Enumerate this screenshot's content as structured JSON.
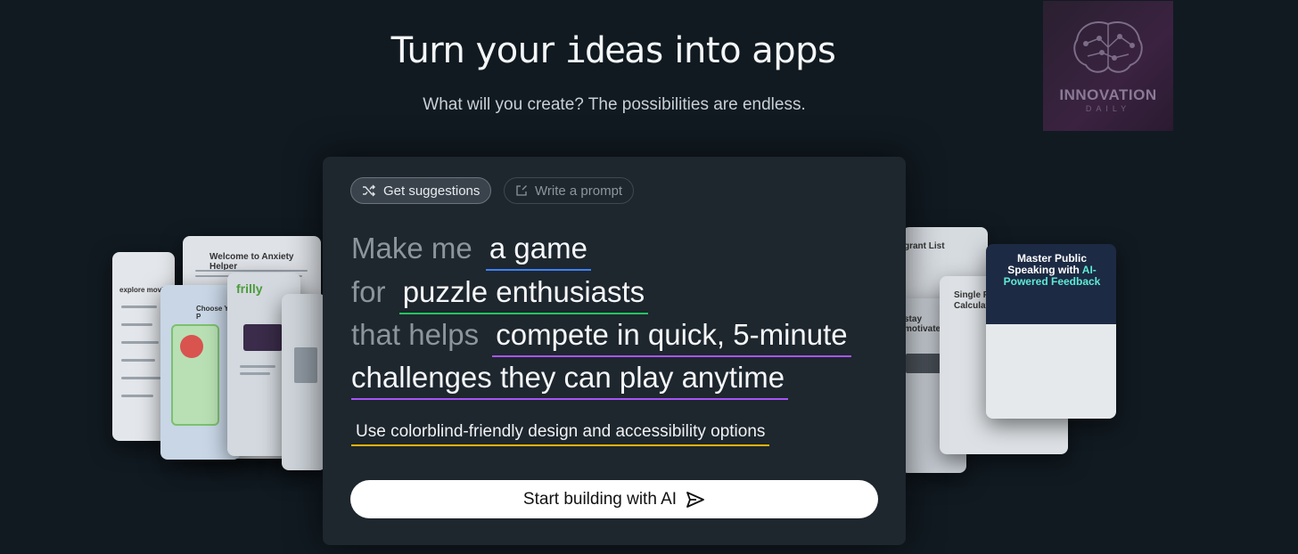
{
  "hero": {
    "title_part1": "Turn your ",
    "title_part2": "ideas",
    "title_part3": " into apps",
    "subtitle": "What will you create? The possibilities are endless."
  },
  "logo": {
    "brand": "INNOVATION",
    "tagline": "DAILY"
  },
  "modes": {
    "suggestions_label": "Get suggestions",
    "prompt_label": "Write a prompt"
  },
  "prompt": {
    "prefix1": "Make me",
    "slot1": "a game",
    "prefix2": "for",
    "slot2": "puzzle enthusiasts",
    "prefix3": "that helps",
    "slot3a": "compete in quick, 5-minute",
    "slot3b": "challenges they can play anytime",
    "detail": "Use colorblind-friendly design and accessibility options"
  },
  "cta": {
    "label": "Start building with AI"
  },
  "preview_cards": {
    "anxiety": "Welcome to Anxiety Helper",
    "movies": "explore movies",
    "pokemon": "Choose Your P",
    "frill": "frilly",
    "grant": "grant List",
    "motivated": "stay motivated",
    "loan": "Single Property Loan Calculator",
    "speaking_title": "Master Public Speaking with",
    "speaking_accent": "AI-Powered Feedback"
  },
  "colors": {
    "background": "#111a21",
    "panel": "#1e262e",
    "slot_blue": "#3b82f6",
    "slot_green": "#22c55e",
    "slot_purple": "#a855f7",
    "detail_yellow": "#eab308"
  }
}
